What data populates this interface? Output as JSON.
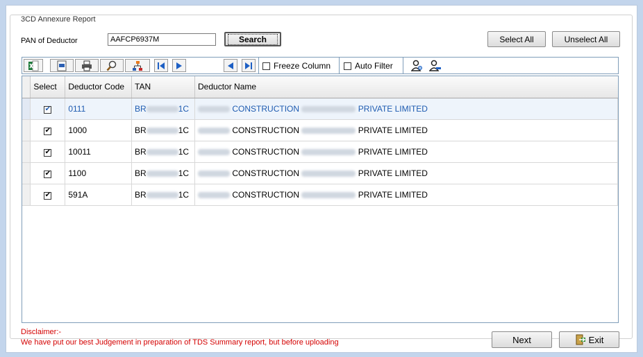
{
  "group_title": "3CD Annexure Report",
  "pan_label": "PAN of Deductor",
  "pan_value": "AAFCP6937M",
  "search_label": "Search",
  "select_all_label": "Select All",
  "unselect_all_label": "Unselect All",
  "toolbar": {
    "freeze_column_label": "Freeze Column",
    "auto_filter_label": "Auto Filter"
  },
  "table": {
    "columns": [
      "Select",
      "Deductor Code",
      "TAN",
      "Deductor Name"
    ],
    "rows": [
      {
        "code": "0111",
        "tan_prefix": "BR",
        "tan_suffix": "1C",
        "name_mid": "CONSTRUCTION",
        "name_end": "PRIVATE LIMITED",
        "checked": true
      },
      {
        "code": "1000",
        "tan_prefix": "BR",
        "tan_suffix": "1C",
        "name_mid": "CONSTRUCTION",
        "name_end": "PRIVATE LIMITED",
        "checked": true
      },
      {
        "code": "10011",
        "tan_prefix": "BR",
        "tan_suffix": "1C",
        "name_mid": "CONSTRUCTION",
        "name_end": "PRIVATE LIMITED",
        "checked": true
      },
      {
        "code": "1100",
        "tan_prefix": "BR",
        "tan_suffix": "1C",
        "name_mid": "CONSTRUCTION",
        "name_end": "PRIVATE LIMITED",
        "checked": true
      },
      {
        "code": "591A",
        "tan_prefix": "BR",
        "tan_suffix": "1C",
        "name_mid": "CONSTRUCTION",
        "name_end": "PRIVATE LIMITED",
        "checked": true
      }
    ]
  },
  "disclaimer_title": "Disclaimer:-",
  "disclaimer_text": "We have put our best Judgement in preparation of TDS Summary report, but before uploading",
  "next_label": "Next",
  "exit_label": "Exit",
  "colors": {
    "disclaimer": "#d40000",
    "selected_row_text": "#1e5bb0",
    "frame": "#c3d5ec"
  }
}
